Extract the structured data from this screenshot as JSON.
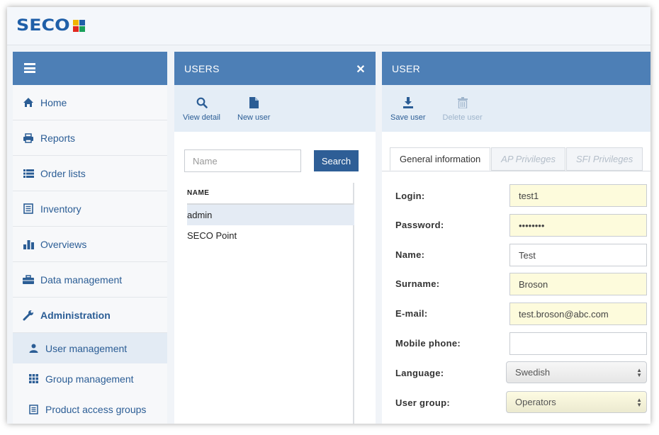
{
  "app": {
    "logo_text": "SECO"
  },
  "sidebar": {
    "items": [
      {
        "label": "Home",
        "icon": "home-icon"
      },
      {
        "label": "Reports",
        "icon": "printer-icon"
      },
      {
        "label": "Order lists",
        "icon": "list-icon"
      },
      {
        "label": "Inventory",
        "icon": "document-icon"
      },
      {
        "label": "Overviews",
        "icon": "bar-chart-icon"
      },
      {
        "label": "Data management",
        "icon": "briefcase-icon"
      },
      {
        "label": "Administration",
        "icon": "wrench-icon"
      }
    ],
    "subitems": [
      {
        "label": "User management",
        "icon": "user-icon",
        "active": true
      },
      {
        "label": "Group management",
        "icon": "grid-icon"
      },
      {
        "label": "Product access groups",
        "icon": "document-icon"
      }
    ]
  },
  "users_panel": {
    "title": "USERS",
    "toolbar": {
      "view_detail": "View detail",
      "new_user": "New user"
    },
    "search": {
      "placeholder": "Name",
      "button": "Search"
    },
    "column_header": "NAME",
    "rows": [
      "admin",
      "SECO Point"
    ]
  },
  "user_panel": {
    "title": "USER",
    "toolbar": {
      "save": "Save user",
      "delete": "Delete user"
    },
    "tabs": [
      "General information",
      "AP Privileges",
      "SFI Privileges"
    ],
    "form": {
      "login_label": "Login:",
      "login_value": "test1",
      "password_label": "Password:",
      "password_value": "••••••••",
      "name_label": "Name:",
      "name_value": "Test",
      "surname_label": "Surname:",
      "surname_value": "Broson",
      "email_label": "E-mail:",
      "email_value": "test.broson@abc.com",
      "mobile_label": "Mobile phone:",
      "mobile_value": "",
      "language_label": "Language:",
      "language_value": "Swedish",
      "group_label": "User group:",
      "group_value": "Operators"
    }
  },
  "colors": {
    "header_blue": "#4d7fb6",
    "link_blue": "#2b5d95",
    "required_yellow": "#fdfbdc",
    "logo_blue": "#1f5fa8"
  }
}
